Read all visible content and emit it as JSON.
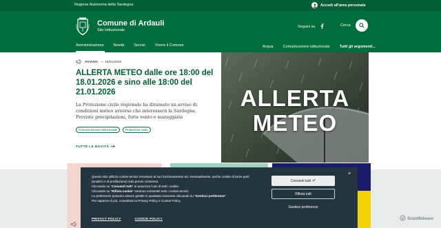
{
  "slim": {
    "region": "Regione Autonoma della Sardegna",
    "login": "Accedi all'area personale"
  },
  "header": {
    "name": "Comune di Ardauli",
    "tagline": "Sito Istituzionale",
    "social_label": "Seguici su",
    "search_label": "Cerca"
  },
  "nav": {
    "main": [
      "Amministrazione",
      "Novità",
      "Servizi",
      "Vivere il Comune"
    ],
    "secondary": [
      "Acqua",
      "Comunicazione istituzionale",
      "Tutti gli argomenti..."
    ]
  },
  "hero": {
    "kicker_type": "AVVISO",
    "kicker_date": "— 18/01/2026",
    "title": "ALLERTA METEO dalle ore 18:00 del 18.01.2026 e sino alle 18:00 del 21.01.2026",
    "text": "La Protezione civile regionale ha diramato un avviso di condizioni meteo avverse che interesserà la Sardegna. Previste precipitazioni, forte vento e mareggiate",
    "chips": [
      "Comunicazione Istituzionale",
      "Protezione civile"
    ],
    "all_news": "TUTTE LE NOVITÀ",
    "image_line1": "ALLERTA",
    "image_line2": "METEO"
  },
  "cookie": {
    "line1": "Questo sito utilizza cookie tecnici necessari al suo funzionamento ed, eventualmente, anche cookie di terze parti (analitici e di profilazione) solo previo consenso.",
    "line2_a": "Cliccando su \"",
    "line2_b": "Consenti tutti",
    "line2_c": "\" si autorizza l'uso di tutti i cookie.",
    "line3_a": "Cliccando su \"",
    "line3_b": "Rifiuta cookie",
    "line3_c": "\" saranno consentiti solo i cookie tecnici.",
    "line4_a": "Le preferenze possono essere gestite in qualsiasi momento cliccando su \"",
    "line4_b": "Gestisci preferenze",
    "line4_c": "\".",
    "line5": "Per saperne di più, consultare la Privacy Policy e Cookie Policy.",
    "privacy": "PRIVACY POLICY",
    "cookie_policy": "COOKIE POLICY",
    "accept": "Consenti tutti",
    "reject": "Rifiuta tutti",
    "manage": "Gestisci preferenze",
    "close": "×"
  },
  "watermark": "ScanMalware",
  "colors": {
    "primary": "#006e3c",
    "dark": "#005f34",
    "banner": "#23353f"
  }
}
